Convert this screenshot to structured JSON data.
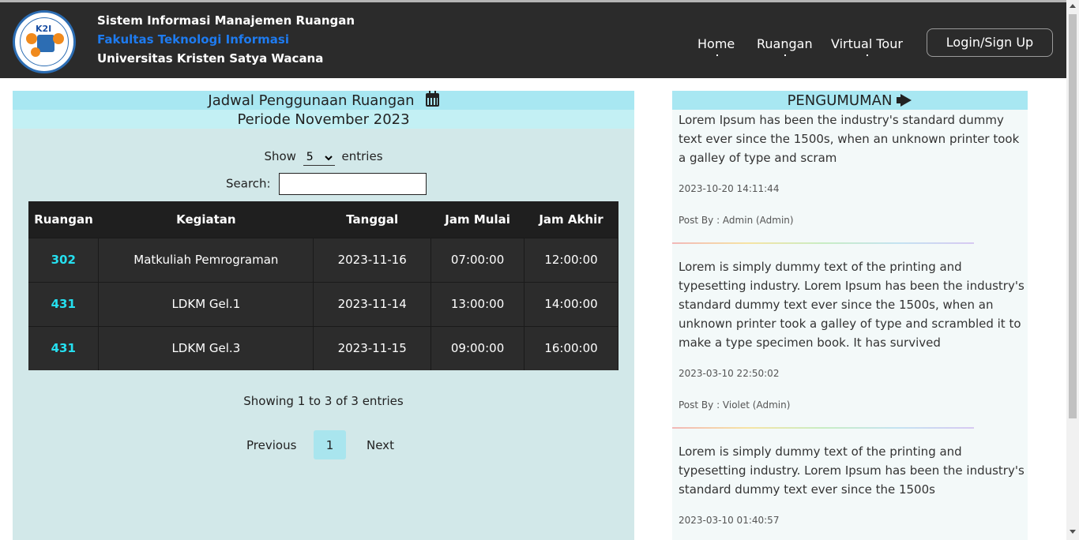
{
  "header": {
    "line1": "Sistem Informasi Manajemen Ruangan",
    "line2": "Fakultas Teknologi Informasi",
    "line3": "Universitas Kristen Satya Wacana",
    "logo_text": "K2I",
    "nav": [
      {
        "label": "Home"
      },
      {
        "label": "Ruangan"
      },
      {
        "label": "Virtual Tour"
      }
    ],
    "login_label": "Login/Sign Up"
  },
  "schedule": {
    "title": "Jadwal Penggunaan Ruangan",
    "period": "Periode November 2023",
    "show_label": "Show",
    "entries_label": "entries",
    "page_size": "5",
    "search_label": "Search:",
    "columns": [
      "Ruangan",
      "Kegiatan",
      "Tanggal",
      "Jam Mulai",
      "Jam Akhir"
    ],
    "rows": [
      {
        "room": "302",
        "activity": "Matkuliah Pemrograman",
        "date": "2023-11-16",
        "start": "07:00:00",
        "end": "12:00:00"
      },
      {
        "room": "431",
        "activity": "LDKM Gel.1",
        "date": "2023-11-14",
        "start": "13:00:00",
        "end": "14:00:00"
      },
      {
        "room": "431",
        "activity": "LDKM Gel.3",
        "date": "2023-11-15",
        "start": "09:00:00",
        "end": "16:00:00"
      }
    ],
    "info": "Showing 1 to 3 of 3 entries",
    "prev_label": "Previous",
    "page": "1",
    "next_label": "Next"
  },
  "announcements": {
    "title": "PENGUMUMAN",
    "posts": [
      {
        "body": "Lorem Ipsum has been the industry's standard dummy text ever since the 1500s, when an unknown printer took a galley of type and scram",
        "date": "2023-10-20 14:11:44",
        "by": "Post By : Admin (Admin)"
      },
      {
        "body": "Lorem is simply dummy text of the printing and typesetting industry. Lorem Ipsum has been the industry's standard dummy text ever since the 1500s, when an unknown printer took a galley of type and scrambled it to make a type specimen book. It has survived",
        "date": "2023-03-10 22:50:02",
        "by": "Post By : Violet (Admin)"
      },
      {
        "body": "Lorem is simply dummy text of the printing and typesetting industry. Lorem Ipsum has been the industry's standard dummy text ever since the 1500s",
        "date": "2023-03-10 01:40:57"
      }
    ]
  },
  "colors": {
    "navbar": "#2b2b2b",
    "accent_blue": "#1e7bf0",
    "room_cyan": "#25e0f0",
    "panel_bg": "#d2e8e9",
    "header_cyan": "#a8e7f2"
  },
  "icons": {
    "calendar": "calendar-icon",
    "announcement": "megaphone-icon"
  }
}
